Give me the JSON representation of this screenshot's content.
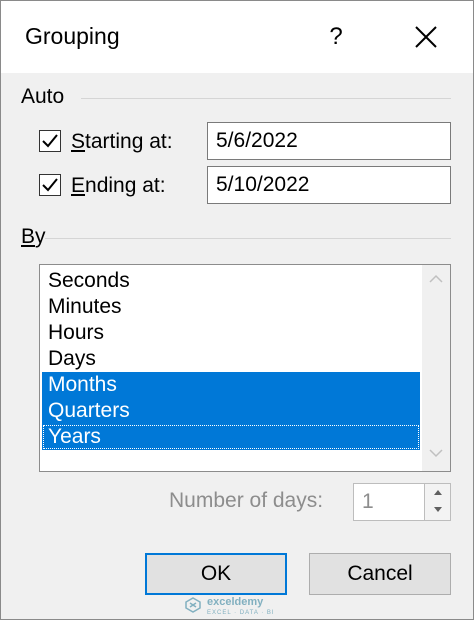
{
  "window": {
    "title": "Grouping",
    "help_label": "?",
    "close_icon": "close-icon"
  },
  "auto": {
    "label": "Auto",
    "starting": {
      "checked": true,
      "label_first": "S",
      "label_rest": "tarting at:",
      "value": "5/6/2022"
    },
    "ending": {
      "checked": true,
      "label_first": "E",
      "label_rest": "nding at:",
      "value": "5/10/2022"
    }
  },
  "by": {
    "label_first": "B",
    "label_rest": "y",
    "items": [
      {
        "label": "Seconds",
        "selected": false
      },
      {
        "label": "Minutes",
        "selected": false
      },
      {
        "label": "Hours",
        "selected": false
      },
      {
        "label": "Days",
        "selected": false
      },
      {
        "label": "Months",
        "selected": true
      },
      {
        "label": "Quarters",
        "selected": true
      },
      {
        "label": "Years",
        "selected": true
      }
    ]
  },
  "number_of_days": {
    "label": "Number of days:",
    "value": "1",
    "enabled": false
  },
  "buttons": {
    "ok": "OK",
    "cancel": "Cancel"
  },
  "watermark": {
    "brand": "exceldemy",
    "tagline": "EXCEL · DATA · BI"
  },
  "colors": {
    "selection": "#0078d7",
    "dialog_bg": "#f0f0f0",
    "default_button_border": "#0078d7",
    "disabled_text": "#8d8d8d"
  }
}
